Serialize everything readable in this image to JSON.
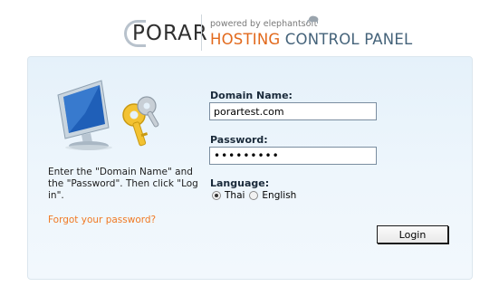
{
  "brand": {
    "logo_text": "PORAR",
    "powered_by": "powered by elephantsoft",
    "product_part1": "HOSTING",
    "product_part2": "CONTROL PANEL"
  },
  "help": {
    "instructions": "Enter the \"Domain Name\" and the \"Password\". Then click \"Log in\".",
    "forgot_link": "Forgot your password?"
  },
  "form": {
    "domain_label": "Domain Name:",
    "domain_value": "porartest.com",
    "password_label": "Password:",
    "password_value": "•••••••••",
    "language_label": "Language:",
    "languages": [
      {
        "label": "Thai",
        "selected": true
      },
      {
        "label": "English",
        "selected": false
      }
    ],
    "login_button": "Login"
  },
  "colors": {
    "accent_orange": "#e2691c",
    "accent_blue": "#45637a",
    "panel_bg": "#e5f1fa",
    "link": "#f07a24"
  },
  "icons": [
    "computer-keys-icon",
    "elephant-icon"
  ]
}
